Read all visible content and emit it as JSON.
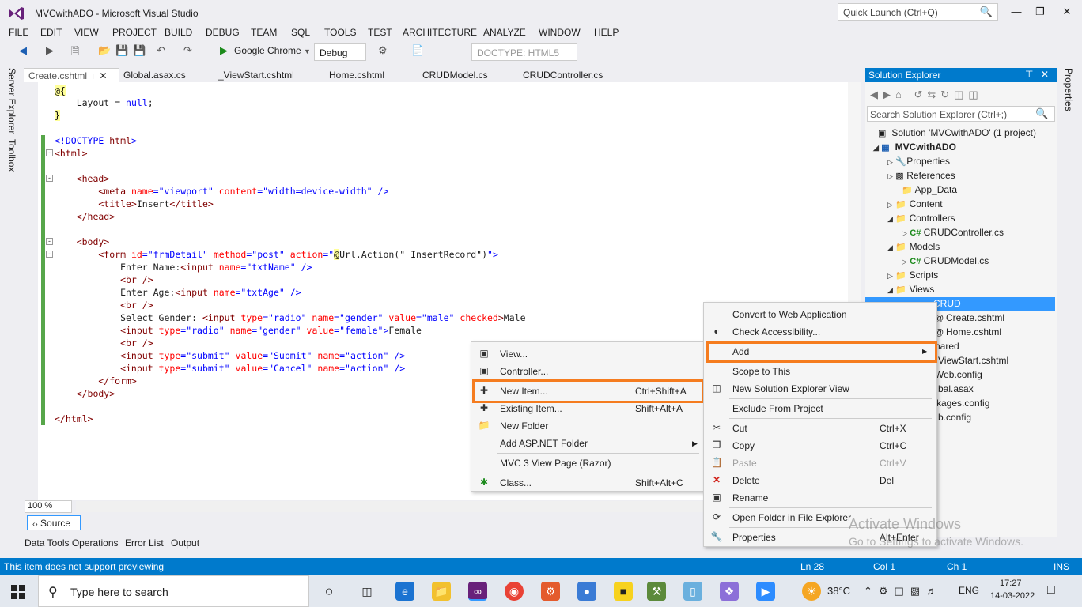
{
  "window": {
    "title": "MVCwithADO - Microsoft Visual Studio",
    "quick_launch_placeholder": "Quick Launch (Ctrl+Q)"
  },
  "menu": [
    "FILE",
    "EDIT",
    "VIEW",
    "PROJECT",
    "BUILD",
    "DEBUG",
    "TEAM",
    "SQL",
    "TOOLS",
    "TEST",
    "ARCHITECTURE",
    "ANALYZE",
    "WINDOW",
    "HELP"
  ],
  "toolbar": {
    "browser": "Google Chrome",
    "config": "Debug",
    "doctype": "DOCTYPE: HTML5"
  },
  "side": {
    "server_explorer": "Server Explorer",
    "toolbox": "Toolbox",
    "properties": "Properties"
  },
  "tabs": [
    "Create.cshtml",
    "Global.asax.cs",
    "_ViewStart.cshtml",
    "Home.cshtml",
    "CRUDModel.cs",
    "CRUDController.cs"
  ],
  "code": {
    "l1": "@{",
    "l2a": "    Layout = ",
    "l2b": "null",
    "l2c": ";",
    "l3": "}",
    "l5a": "<!DOCTYPE ",
    "l5b": "html",
    "l5c": ">",
    "l6": "<html>",
    "l8": "    <head>",
    "l9a": "        <meta ",
    "l9b": "name",
    "l9c": "=\"viewport\" ",
    "l9d": "content",
    "l9e": "=\"width=device-width\" />",
    "l10a": "        <title>",
    "l10b": "Insert",
    "l10c": "</title>",
    "l11": "    </head>",
    "l13": "    <body>",
    "l14a": "        <form ",
    "l14b": "id",
    "l14c": "=\"frmDetail\" ",
    "l14d": "method",
    "l14e": "=\"post\" ",
    "l14f": "action",
    "l14g": "=\"",
    "l14h": "@",
    "l14i": "Url.Action(\" InsertRecord\")",
    "l14j": "\">",
    "l15a": "            Enter Name:",
    "l15b": "<input ",
    "l15c": "name",
    "l15d": "=\"txtName\" />",
    "l16": "            <br />",
    "l17a": "            Enter Age:",
    "l17b": "<input ",
    "l17c": "name",
    "l17d": "=\"txtAge\" />",
    "l18": "            <br />",
    "l19a": "            Select Gender: ",
    "l19b": "<input ",
    "l19c": "type",
    "l19d": "=\"radio\" ",
    "l19e": "name",
    "l19f": "=\"gender\" ",
    "l19g": "value",
    "l19h": "=\"male\" ",
    "l19i": "checked",
    "l19j": ">",
    "l19k": "Male",
    "l20a": "            <input ",
    "l20b": "type",
    "l20c": "=\"radio\" ",
    "l20d": "name",
    "l20e": "=\"gender\" ",
    "l20f": "value",
    "l20g": "=\"female\">",
    "l20h": "Female",
    "l21": "            <br />",
    "l22a": "            <input ",
    "l22b": "type",
    "l22c": "=\"submit\" ",
    "l22d": "value",
    "l22e": "=\"Submit\" ",
    "l22f": "name",
    "l22g": "=\"action\" />",
    "l23a": "            <input ",
    "l23b": "type",
    "l23c": "=\"submit\" ",
    "l23d": "value",
    "l23e": "=\"Cancel\" ",
    "l23f": "name",
    "l23g": "=\"action\" />",
    "l24": "        </form>",
    "l25": "    </body>",
    "l27": "</html>"
  },
  "editor": {
    "zoom": "100 %",
    "source_tab": "Source"
  },
  "bottom_tabs": [
    "Data Tools Operations",
    "Error List",
    "Output"
  ],
  "solution": {
    "title": "Solution Explorer",
    "search_placeholder": "Search Solution Explorer (Ctrl+;)",
    "nodes": [
      "Solution 'MVCwithADO' (1 project)",
      "MVCwithADO",
      "Properties",
      "References",
      "App_Data",
      "Content",
      "Controllers",
      "CRUDController.cs",
      "Models",
      "CRUDModel.cs",
      "Scripts",
      "Views",
      "CRUD",
      "Create.cshtml",
      "Home.cshtml",
      "hared",
      "ViewStart.cshtml",
      "Web.config",
      "bal.asax",
      "kages.config",
      "b.config"
    ]
  },
  "context_menu_main": [
    {
      "label": "Convert to Web Application",
      "shortcut": ""
    },
    {
      "label": "Check Accessibility...",
      "shortcut": ""
    },
    {
      "label": "Add",
      "shortcut": ""
    },
    {
      "label": "Scope to This",
      "shortcut": ""
    },
    {
      "label": "New Solution Explorer View",
      "shortcut": ""
    },
    {
      "label": "Exclude From Project",
      "shortcut": ""
    },
    {
      "label": "Cut",
      "shortcut": "Ctrl+X"
    },
    {
      "label": "Copy",
      "shortcut": "Ctrl+C"
    },
    {
      "label": "Paste",
      "shortcut": "Ctrl+V"
    },
    {
      "label": "Delete",
      "shortcut": "Del"
    },
    {
      "label": "Rename",
      "shortcut": ""
    },
    {
      "label": "Open Folder in File Explorer",
      "shortcut": ""
    },
    {
      "label": "Properties",
      "shortcut": "Alt+Enter"
    }
  ],
  "context_menu_add": [
    {
      "label": "View...",
      "shortcut": ""
    },
    {
      "label": "Controller...",
      "shortcut": ""
    },
    {
      "label": "New Item...",
      "shortcut": "Ctrl+Shift+A"
    },
    {
      "label": "Existing Item...",
      "shortcut": "Shift+Alt+A"
    },
    {
      "label": "New Folder",
      "shortcut": ""
    },
    {
      "label": "Add ASP.NET Folder",
      "shortcut": ""
    },
    {
      "label": "MVC 3 View Page (Razor)",
      "shortcut": ""
    },
    {
      "label": "Class...",
      "shortcut": "Shift+Alt+C"
    }
  ],
  "status": {
    "message": "This item does not support previewing",
    "line": "Ln 28",
    "col": "Col 1",
    "ch": "Ch 1",
    "mode": "INS"
  },
  "watermark": {
    "line1": "Activate Windows",
    "line2": "Go to Settings to activate Windows."
  },
  "taskbar": {
    "search": "Type here to search",
    "weather": "38°C",
    "lang": "ENG",
    "time": "17:27",
    "date": "14-03-2022"
  },
  "colors": {
    "accent": "#007acc",
    "highlight": "#f57c1f",
    "selection": "#3399ff"
  }
}
